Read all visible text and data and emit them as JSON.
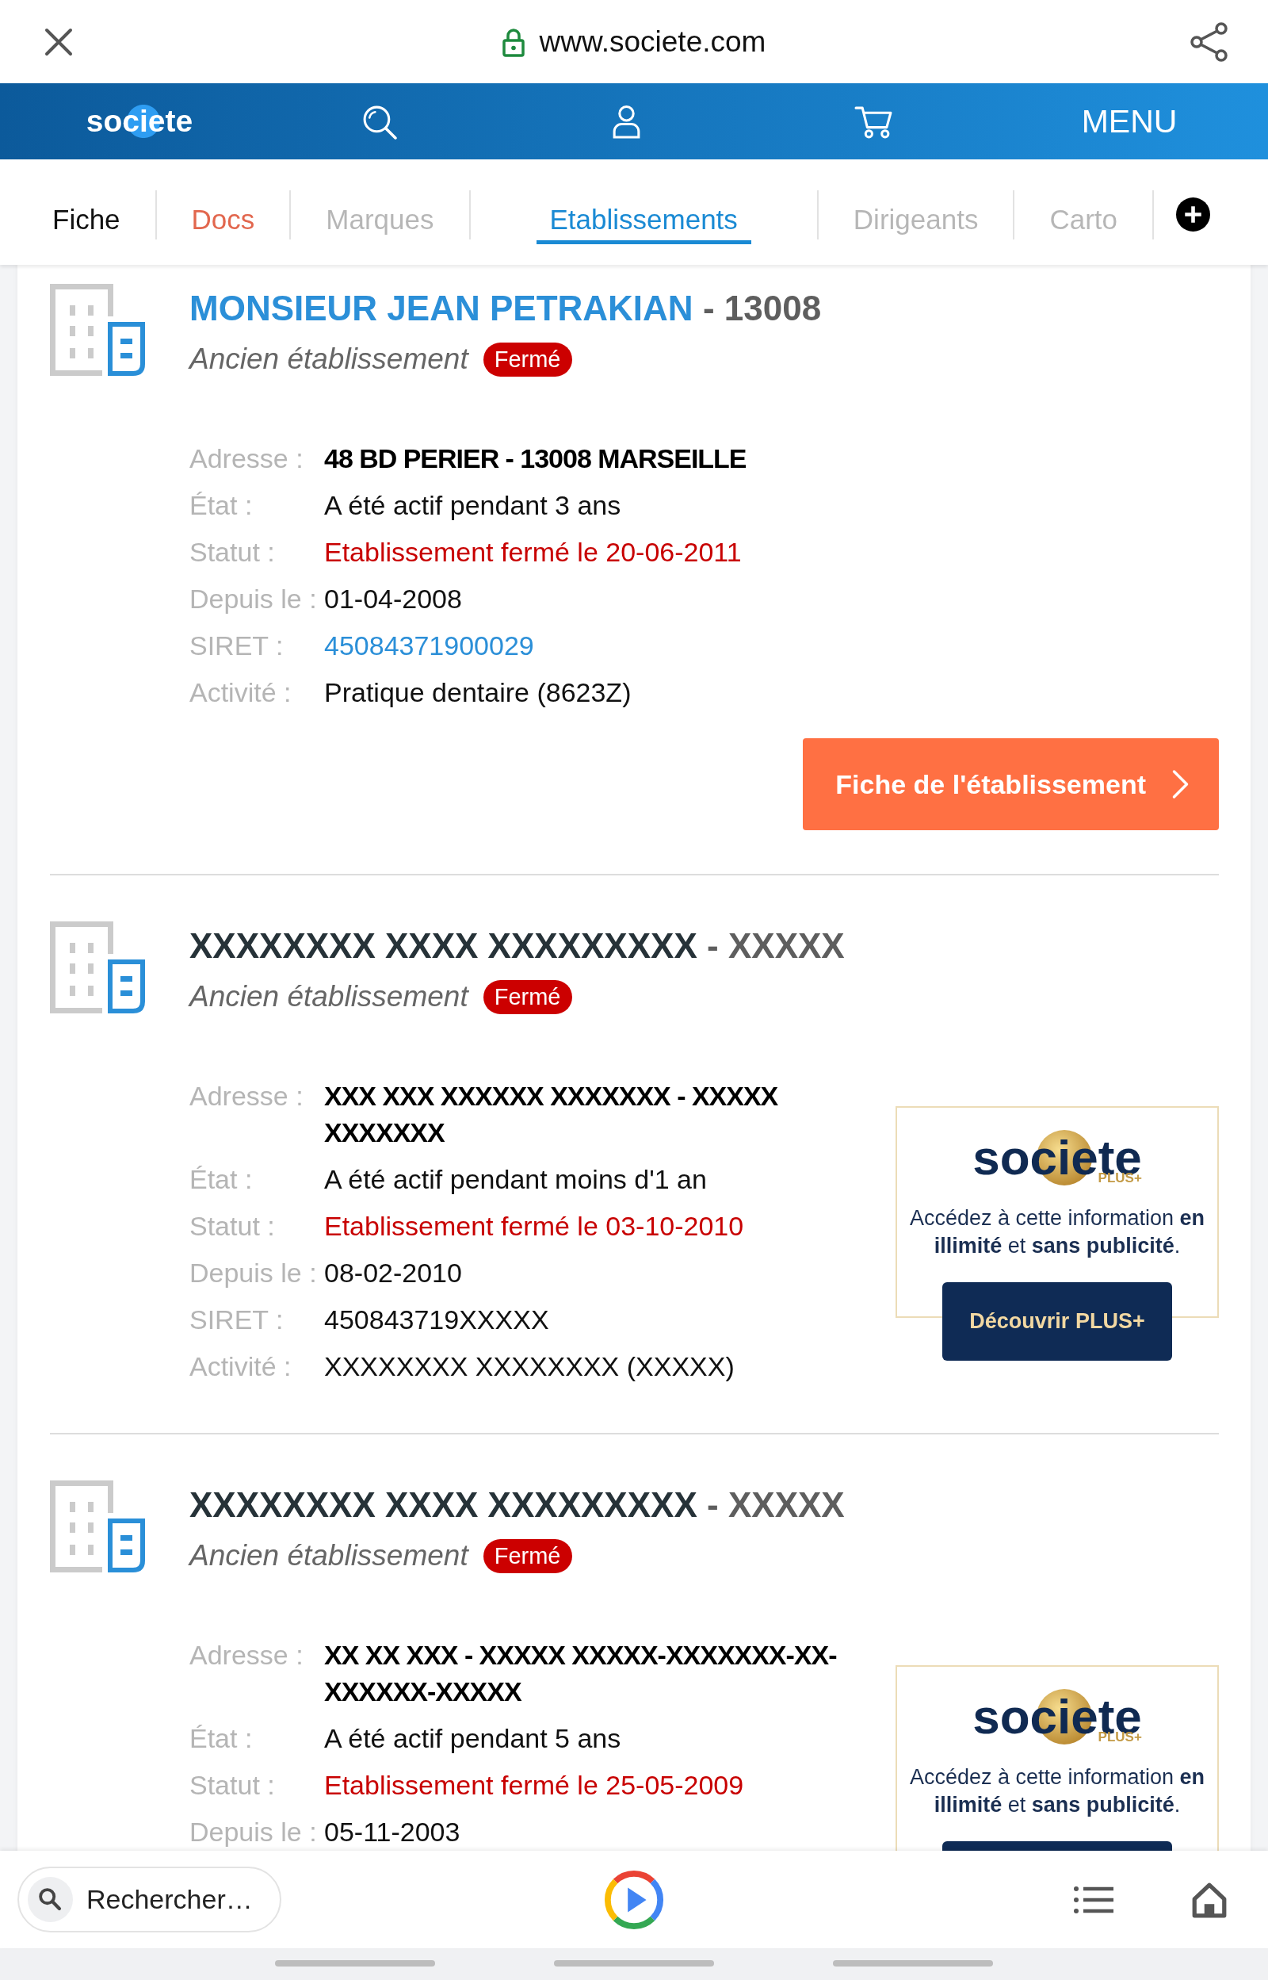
{
  "browser": {
    "url": "www.societe.com"
  },
  "header": {
    "logo": "societe",
    "menu": "MENU"
  },
  "tabs": [
    {
      "label": "Fiche",
      "selected": false,
      "disabled": false,
      "highlighted": false
    },
    {
      "label": "Docs",
      "selected": false,
      "disabled": false,
      "highlighted": true
    },
    {
      "label": "Marques",
      "selected": false,
      "disabled": true,
      "highlighted": false
    },
    {
      "label": "Etablissements",
      "selected": true,
      "disabled": false,
      "highlighted": false
    },
    {
      "label": "Dirigeants",
      "selected": false,
      "disabled": true,
      "highlighted": false
    },
    {
      "label": "Carto",
      "selected": false,
      "disabled": true,
      "highlighted": false
    }
  ],
  "establishments": [
    {
      "name": "MONSIEUR JEAN PETRAKIAN",
      "postcode": "- 13008",
      "linked": true,
      "subtitle": "Ancien établissement",
      "badge": "Fermé",
      "fields": [
        {
          "label": "Adresse :",
          "value": "48 BD PERIER - 13008 MARSEILLE",
          "kind": "address"
        },
        {
          "label": "État :",
          "value": "A été actif pendant 3 ans",
          "kind": "text"
        },
        {
          "label": "Statut :",
          "value": "Etablissement fermé le 20-06-2011",
          "kind": "status"
        },
        {
          "label": "Depuis le :",
          "value": "01-04-2008",
          "kind": "text"
        },
        {
          "label": "SIRET :",
          "value": "45084371900029",
          "kind": "link"
        },
        {
          "label": "Activité :",
          "value": "Pratique dentaire (8623Z)",
          "kind": "text"
        }
      ],
      "button": "Fiche de l'établissement"
    },
    {
      "name": "XXXXXXXX XXXX XXXXXXXXX",
      "postcode": "- XXXXX",
      "linked": false,
      "subtitle": "Ancien établissement",
      "badge": "Fermé",
      "fields": [
        {
          "label": "Adresse :",
          "value": "XXX XXX XXXXXX XXXXXXX - XXXXX XXXXXXX",
          "kind": "address"
        },
        {
          "label": "État :",
          "value": "A été actif pendant moins d'1 an",
          "kind": "text"
        },
        {
          "label": "Statut :",
          "value": "Etablissement fermé le 03-10-2010",
          "kind": "status"
        },
        {
          "label": "Depuis le :",
          "value": "08-02-2010",
          "kind": "text"
        },
        {
          "label": "SIRET :",
          "value": "450843719XXXXX",
          "kind": "text"
        },
        {
          "label": "Activité :",
          "value": "XXXXXXXX XXXXXXXX (XXXXX)",
          "kind": "text"
        }
      ],
      "promo": {
        "logo": "societe",
        "logo_tag": "PLUS+",
        "text": "Accédez à cette information **en illimité** et **sans publicité**.",
        "button": "Découvrir PLUS+"
      }
    },
    {
      "name": "XXXXXXXX XXXX XXXXXXXXX",
      "postcode": "- XXXXX",
      "linked": false,
      "subtitle": "Ancien établissement",
      "badge": "Fermé",
      "fields": [
        {
          "label": "Adresse :",
          "value": "XX XX XXX - XXXXX XXXXX-XXXXXXX-XX-XXXXXX-XXXXX",
          "kind": "address"
        },
        {
          "label": "État :",
          "value": "A été actif pendant 5 ans",
          "kind": "text"
        },
        {
          "label": "Statut :",
          "value": "Etablissement fermé le 25-05-2009",
          "kind": "status"
        },
        {
          "label": "Depuis le :",
          "value": "05-11-2003",
          "kind": "text"
        }
      ],
      "promo": {
        "logo": "societe",
        "logo_tag": "PLUS+",
        "text": "Accédez à cette information **en illimité** et **sans publicité**."
      }
    }
  ],
  "bottom_bar": {
    "search": {
      "placeholder": "Rechercher…"
    }
  }
}
